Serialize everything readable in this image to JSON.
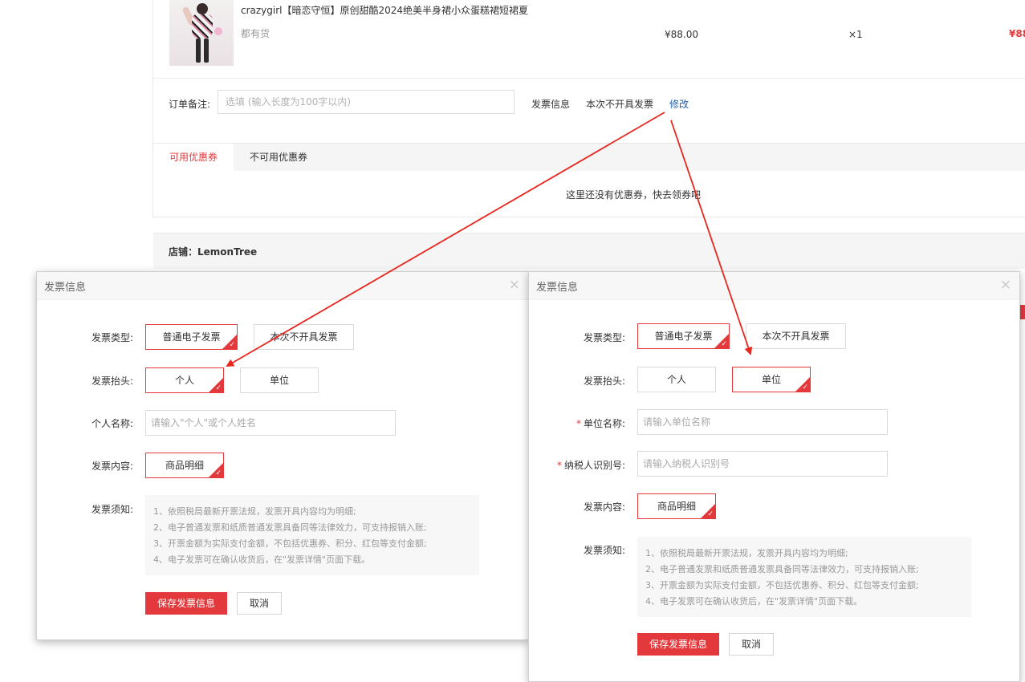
{
  "order": {
    "product_title": "crazygirl【暗恋守恒】原创甜酷2024绝美半身裙小众蛋糕裙短裙夏",
    "stock_status": "都有货",
    "price": "¥88.00",
    "quantity": "×1",
    "subtotal": "¥88",
    "remark_label": "订单备注:",
    "remark_placeholder": "选填 (输入长度为100字以内)",
    "invoice_label": "发票信息",
    "invoice_status": "本次不开具发票",
    "invoice_modify": "修改",
    "coupon_tabs": [
      "可用优惠券",
      "不可用优惠券"
    ],
    "coupon_empty": "这里还没有优惠券，快去领券吧",
    "shop_name": "店铺：LemonTree"
  },
  "dialog_personal": {
    "title": "发票信息",
    "close_glyph": "×",
    "type_label": "发票类型:",
    "type_options": [
      "普通电子发票",
      "本次不开具发票"
    ],
    "header_label": "发票抬头:",
    "header_options": [
      "个人",
      "单位"
    ],
    "name_label": "个人名称:",
    "name_placeholder": "请输入\"个人\"或个人姓名",
    "content_label": "发票内容:",
    "content_option": "商品明细",
    "notice_label": "发票须知:",
    "notice_lines": [
      "1、依照税局最新开票法规，发票开具内容均为明细;",
      "2、电子普通发票和纸质普通发票具备同等法律效力，可支持报销入账;",
      "3、开票金额为实际支付金额，不包括优惠券、积分、红包等支付金额;",
      "4、电子发票可在确认收货后，在\"发票详情\"页面下载。"
    ],
    "save_label": "保存发票信息",
    "cancel_label": "取消"
  },
  "dialog_company": {
    "title": "发票信息",
    "close_glyph": "×",
    "type_label": "发票类型:",
    "type_options": [
      "普通电子发票",
      "本次不开具发票"
    ],
    "header_label": "发票抬头:",
    "header_options": [
      "个人",
      "单位"
    ],
    "required_mark": "*",
    "company_label": "单位名称:",
    "company_placeholder": "请输入单位名称",
    "tax_label": "纳税人识别号:",
    "tax_placeholder": "请输入纳税人识别号",
    "content_label": "发票内容:",
    "content_option": "商品明细",
    "notice_label": "发票须知:",
    "notice_lines": [
      "1、依照税局最新开票法规，发票开具内容均为明细;",
      "2、电子普通发票和纸质普通发票具备同等法律效力，可支持报销入账;",
      "3、开票金额为实际支付金额，不包括优惠券、积分、红包等支付金额;",
      "4、电子发票可在确认收货后，在\"发票详情\"页面下载。"
    ],
    "save_label": "保存发票信息",
    "cancel_label": "取消"
  },
  "check_glyph": "✓",
  "accent_color": "#e4393c",
  "link_color": "#1f5fa8"
}
